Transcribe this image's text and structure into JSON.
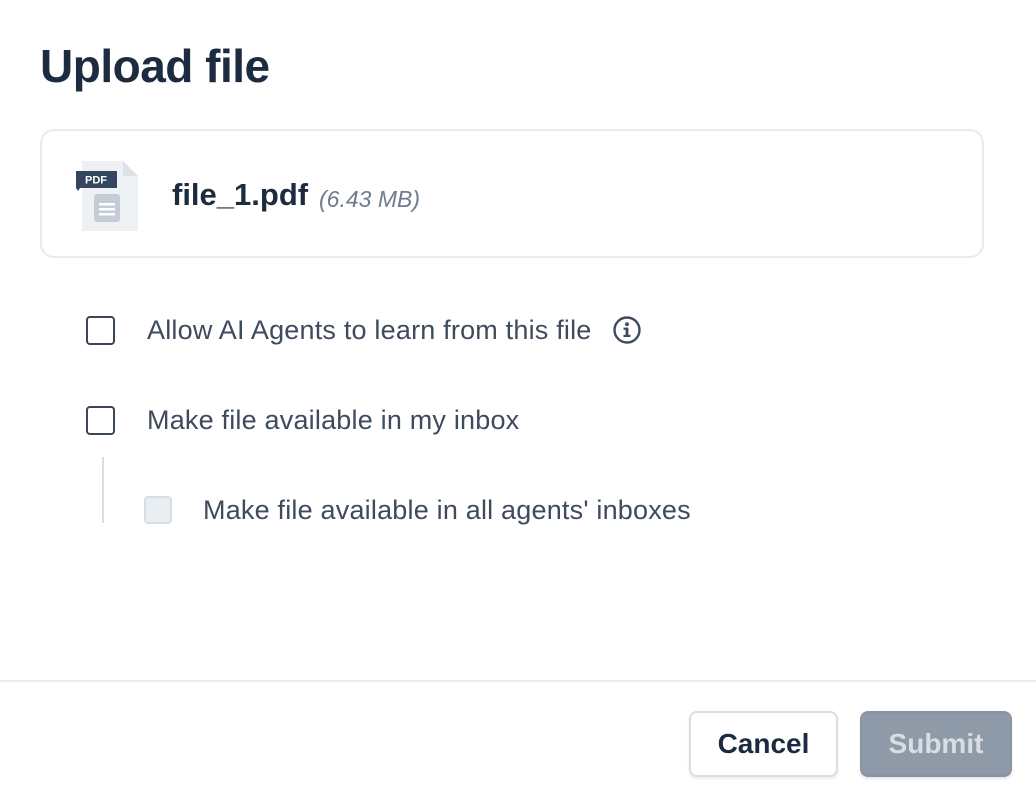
{
  "dialog": {
    "title": "Upload file"
  },
  "file": {
    "icon_label": "PDF",
    "name": "file_1.pdf",
    "size": "(6.43 MB)"
  },
  "options": {
    "learn": {
      "label": "Allow AI Agents to learn from this file",
      "checked": false,
      "icon": "info-icon"
    },
    "my_inbox": {
      "label": "Make file available in my inbox",
      "checked": false
    },
    "all_inboxes": {
      "label": "Make file available in all agents' inboxes",
      "checked": false,
      "disabled": true
    }
  },
  "footer": {
    "cancel_label": "Cancel",
    "submit_label": "Submit"
  },
  "colors": {
    "title": "#1c2b3f",
    "text": "#3f4b5c",
    "muted": "#6f7c8b",
    "submit_disabled_bg": "#8e9aa8",
    "border": "#e8ecf0"
  }
}
